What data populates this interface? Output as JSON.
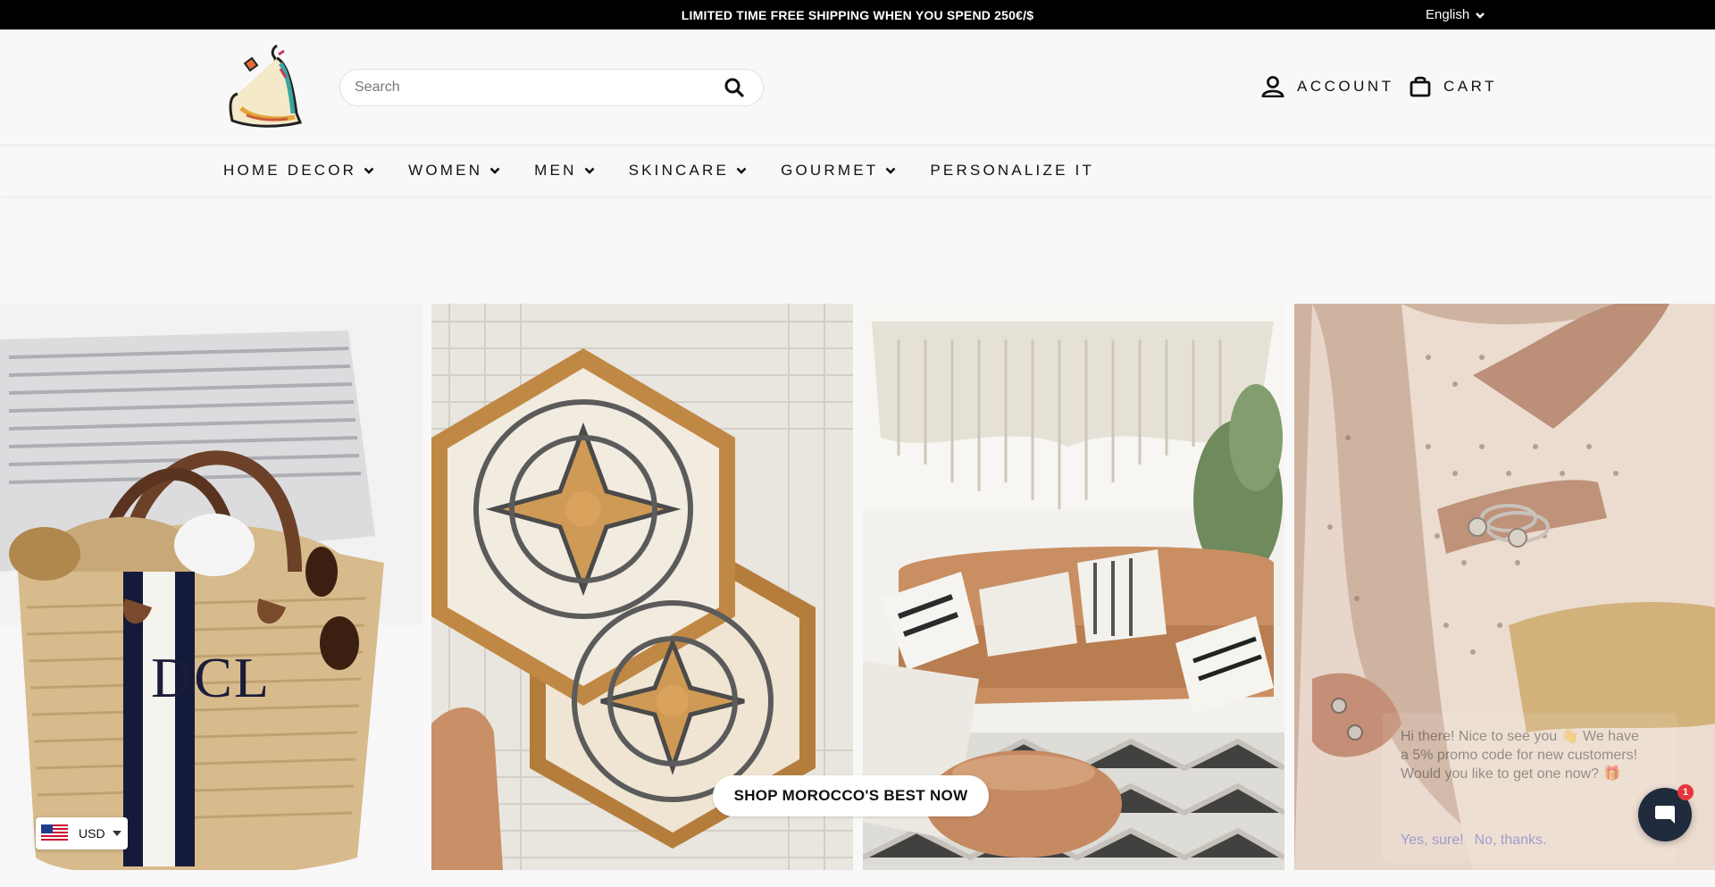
{
  "topbar": {
    "promo": "LIMITED TIME FREE SHIPPING WHEN YOU SPEND 250€/$",
    "language": "English"
  },
  "header": {
    "search_placeholder": "Search",
    "account_label": "ACCOUNT",
    "cart_label": "CART"
  },
  "nav": {
    "items": [
      {
        "label": "HOME DECOR",
        "has_dropdown": true
      },
      {
        "label": "WOMEN",
        "has_dropdown": true
      },
      {
        "label": "MEN",
        "has_dropdown": true
      },
      {
        "label": "SKINCARE",
        "has_dropdown": true
      },
      {
        "label": "GOURMET",
        "has_dropdown": true
      },
      {
        "label": "PERSONALIZE IT",
        "has_dropdown": false
      }
    ]
  },
  "hero": {
    "cta_label": "SHOP MOROCCO'S BEST NOW",
    "tiles": [
      {
        "subject": "straw basket bag",
        "monogram": "DCL"
      },
      {
        "subject": "hexagonal geometric trays"
      },
      {
        "subject": "macrame wall hanging and leather sofa"
      },
      {
        "subject": "woman wearing bracelets"
      }
    ]
  },
  "currency": {
    "code": "USD",
    "flag_icon": "us-flag-icon"
  },
  "chat": {
    "message": "Hi there! Nice to see you 👋 We have a 5% promo code for new customers! Would you like to get one now? 🎁",
    "yes_label": "Yes, sure!",
    "no_label": "No, thanks.",
    "badge_count": "1"
  },
  "colors": {
    "topbar_bg": "#000000",
    "page_bg": "#f8f8f9",
    "chat_button": "#1f2b3c",
    "badge": "#e5363d"
  }
}
